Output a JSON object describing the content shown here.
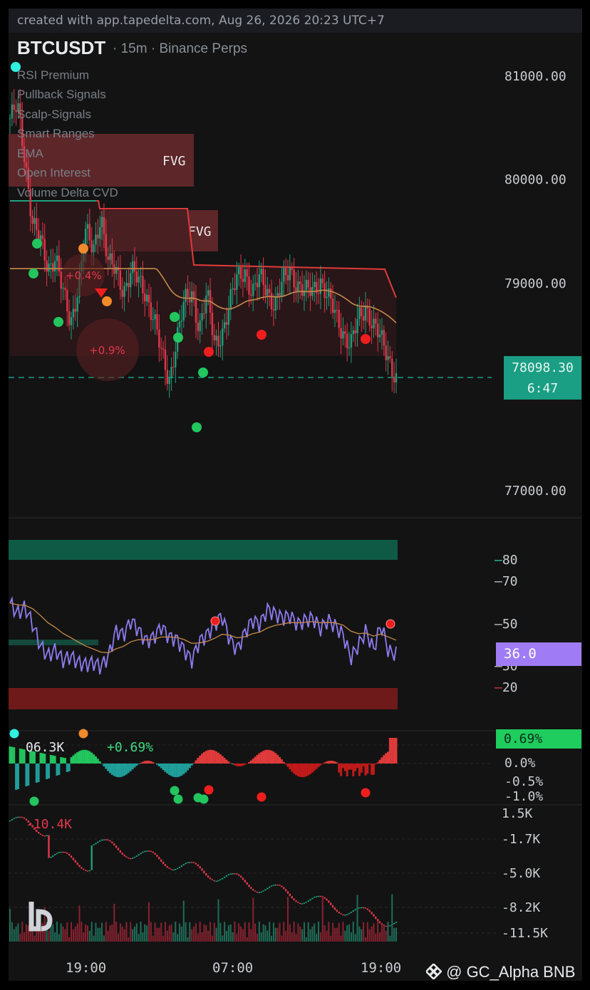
{
  "banner": "created with app.tapedelta.com, Aug 26, 2026 20:23 UTC+7",
  "symbol": "BTCUSDT",
  "timeframe": "· 15m · Binance Perps",
  "indicators": [
    "RSI Premium",
    "Pullback Signals",
    "Scalp-Signals",
    "Smart Ranges",
    "EMA",
    "Open Interest",
    "Volume Delta CVD"
  ],
  "price_axis": [
    "81000.00",
    "80000.00",
    "79000.00",
    "77000.00"
  ],
  "price_tag": {
    "price": "78098.30",
    "countdown": "6:47"
  },
  "fvg_labels": [
    "FVG",
    "FVG"
  ],
  "bubbles": [
    "+0.4%",
    "+0.9%"
  ],
  "rsi_axis": [
    "80",
    "70",
    "50",
    "30",
    "20"
  ],
  "rsi_tag": "36.0",
  "oi_axis": [
    "0.0%",
    "-0.5%",
    "-1.0%"
  ],
  "oi_tag": "0.69%",
  "oi_labels": {
    "oi_value": "06.3K",
    "oi_pct": "+0.69%"
  },
  "cvd_axis": [
    "1.5K",
    "-1.7K",
    "-5.0K",
    "-8.2K",
    "-11.5K"
  ],
  "cvd_label": "-10.4K",
  "x_axis": [
    "19:00",
    "07:00",
    "19:00"
  ],
  "credit": "@ GC_Alpha BNB",
  "colors": {
    "up": "#1f9e7a",
    "down": "#e0384a",
    "signal_green": "#22c55e",
    "signal_red": "#ef1e1e",
    "signal_orange": "#f08a2a",
    "rsi_line": "#8f7bf0",
    "ema": "#c88a4a",
    "range_top": "#e23a3a",
    "fvg_box": "#6b2a2e",
    "teal_band": "#0e5a45",
    "red_band": "#6e1a1a",
    "last_price_line": "#1a9e84"
  },
  "chart_data": {
    "type": "candlestick",
    "title": "BTCUSDT",
    "x_ticks": [
      "19:00",
      "07:00",
      "19:00"
    ],
    "y_ticks": [
      81000,
      80000,
      79000,
      77000
    ],
    "last_price": 78098.3,
    "ylim": [
      76800,
      81400
    ],
    "price_path": [
      80600,
      80700,
      80200,
      79600,
      79400,
      79150,
      79300,
      78900,
      78600,
      79000,
      79500,
      79300,
      79700,
      79200,
      79100,
      78950,
      79150,
      79000,
      78900,
      78700,
      78300,
      78050,
      78500,
      78800,
      78900,
      78600,
      78900,
      78400,
      78550,
      78800,
      79050,
      79150,
      78900,
      79050,
      78950,
      78800,
      79000,
      79150,
      79000,
      78900,
      78950,
      79050,
      78850,
      78700,
      78550,
      78400,
      78650,
      78800,
      78600,
      78450,
      78300,
      78100
    ],
    "rsi": {
      "ylim": [
        10,
        90
      ],
      "levels": [
        80,
        70,
        50,
        30,
        20
      ],
      "last": 36.0,
      "values": [
        60,
        55,
        58,
        50,
        40,
        35,
        38,
        33,
        35,
        32,
        31,
        32,
        30,
        35,
        47,
        45,
        52,
        47,
        42,
        44,
        49,
        44,
        43,
        38,
        33,
        42,
        45,
        50,
        54,
        43,
        38,
        46,
        52,
        50,
        57,
        55,
        53,
        54,
        50,
        52,
        53,
        48,
        52,
        49,
        45,
        34,
        40,
        47,
        38,
        50,
        37,
        36
      ]
    },
    "cvd_ylim": [
      -11500,
      1500
    ],
    "cvd_ticks": [
      1500,
      -1700,
      -5000,
      -8200,
      -11500
    ],
    "cvd_last": -10400
  }
}
